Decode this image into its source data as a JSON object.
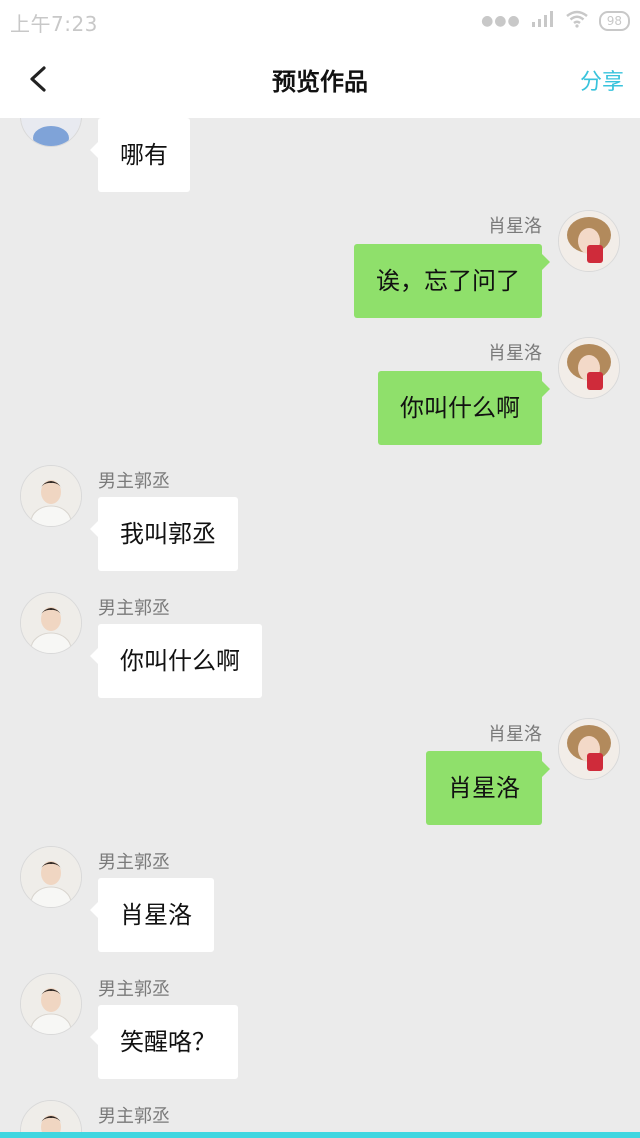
{
  "status": {
    "time": "上午7:23",
    "battery": "98"
  },
  "header": {
    "title": "预览作品",
    "share": "分享"
  },
  "messages": [
    {
      "side": "left",
      "sender": "",
      "text": "哪有"
    },
    {
      "side": "right",
      "sender": "肖星洛",
      "text": "诶，忘了问了"
    },
    {
      "side": "right",
      "sender": "肖星洛",
      "text": "你叫什么啊"
    },
    {
      "side": "left",
      "sender": "男主郭丞",
      "text": "我叫郭丞"
    },
    {
      "side": "left",
      "sender": "男主郭丞",
      "text": "你叫什么啊"
    },
    {
      "side": "right",
      "sender": "肖星洛",
      "text": "肖星洛"
    },
    {
      "side": "left",
      "sender": "男主郭丞",
      "text": "肖星洛"
    },
    {
      "side": "left",
      "sender": "男主郭丞",
      "text": "笑醒咯？"
    },
    {
      "side": "left",
      "sender": "男主郭丞",
      "text": ""
    }
  ],
  "colors": {
    "accent": "#39c3dc",
    "right_bubble": "#8fe06b",
    "background": "#ebebeb"
  }
}
